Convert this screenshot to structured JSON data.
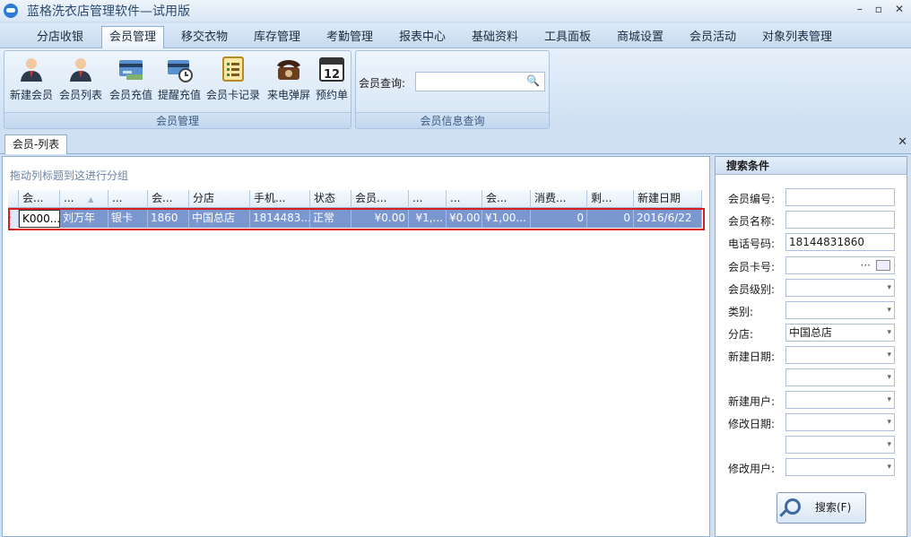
{
  "window": {
    "title": "蓝格洗衣店管理软件—试用版",
    "controls": [
      "–",
      "▫",
      "✕"
    ]
  },
  "menu_tabs": [
    "分店收银",
    "会员管理",
    "移交衣物",
    "库存管理",
    "考勤管理",
    "报表中心",
    "基础资料",
    "工具面板",
    "商城设置",
    "会员活动",
    "对象列表管理"
  ],
  "active_tab": "会员管理",
  "ribbon": {
    "buttons": [
      "新建会员",
      "会员列表",
      "会员充值",
      "提醒充值",
      "会员卡记录",
      "来电弹屏",
      "预约单"
    ],
    "group1_label": "会员管理",
    "search_label": "会员查询:",
    "search_value": "",
    "group2_label": "会员信息查询",
    "calendar_day": "12"
  },
  "doc_tab": "会员-列表",
  "grid": {
    "group_hint": "拖动列标题到这进行分组",
    "columns": [
      "会...",
      "...",
      "...",
      "会...",
      "分店",
      "手机...",
      "状态",
      "会员...",
      "...",
      "...",
      "会...",
      "消费...",
      "剩...",
      "新建日期"
    ],
    "rows": [
      [
        "K000...",
        "刘万年",
        "银卡",
        "1860",
        "中国总店",
        "1814483...",
        "正常",
        "¥0.00",
        "¥1,...",
        "¥0.00",
        "¥1,00...",
        "0",
        "0",
        "2016/6/22"
      ]
    ]
  },
  "side": {
    "title": "搜索条件",
    "fields": [
      {
        "label": "会员编号:",
        "value": ""
      },
      {
        "label": "会员名称:",
        "value": ""
      },
      {
        "label": "电话号码:",
        "value": "18144831860"
      },
      {
        "label": "会员卡号:",
        "value": ""
      },
      {
        "label": "会员级别:",
        "value": ""
      },
      {
        "label": "类别:",
        "value": ""
      },
      {
        "label": "分店:",
        "value": "中国总店"
      },
      {
        "label": "新建日期:",
        "value": ""
      },
      {
        "label": "",
        "value": ""
      },
      {
        "label": "新建用户:",
        "value": ""
      },
      {
        "label": "修改日期:",
        "value": ""
      },
      {
        "label": "",
        "value": ""
      },
      {
        "label": "修改用户:",
        "value": ""
      }
    ],
    "search_button": "搜索(F)"
  }
}
